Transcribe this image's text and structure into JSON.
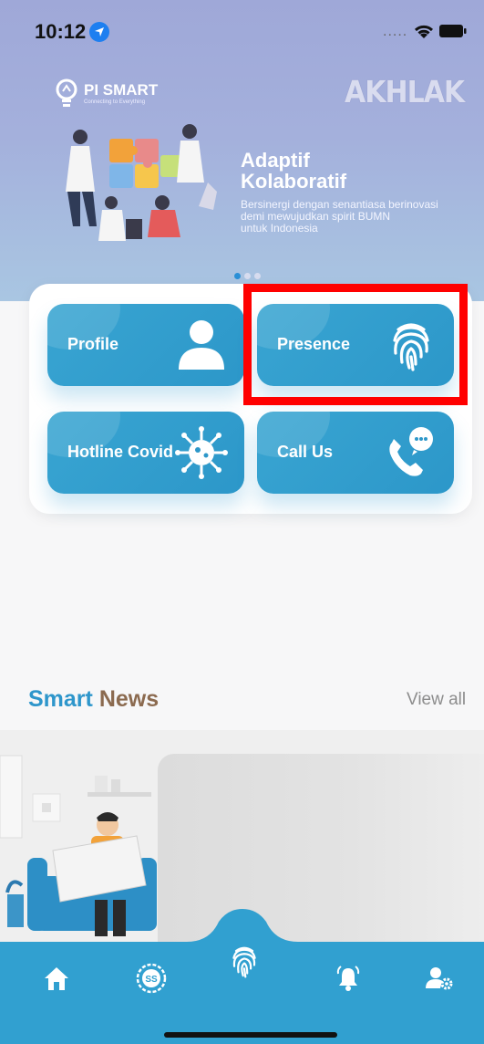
{
  "status_bar": {
    "time": "10:12",
    "signal_dots": "....."
  },
  "banner": {
    "logo_left_title": "PI SMART",
    "logo_left_sub": "Connecting to Everything",
    "logo_right": "AKHLAK",
    "title_line1": "Adaptif",
    "title_line2": "Kolaboratif",
    "desc_line1": "Bersinergi dengan senantiasa berinovasi",
    "desc_line2": "demi mewujudkan spirit BUMN",
    "desc_line3": "untuk Indonesia",
    "pager_count": 3,
    "pager_active": 0
  },
  "menu": {
    "items": [
      {
        "label": "Profile",
        "icon": "person-icon"
      },
      {
        "label": "Presence",
        "icon": "fingerprint-icon"
      },
      {
        "label": "Hotline Covid",
        "icon": "virus-icon"
      },
      {
        "label": "Call Us",
        "icon": "phone-chat-icon"
      }
    ]
  },
  "news": {
    "title_part1": "Smart",
    "title_part2": "News",
    "view_all": "View all"
  },
  "bottom_nav": {
    "items": [
      {
        "name": "home-icon"
      },
      {
        "name": "ss-icon",
        "text": "SS"
      },
      {
        "name": "fingerprint-icon"
      },
      {
        "name": "bell-icon"
      },
      {
        "name": "user-settings-icon"
      }
    ]
  },
  "colors": {
    "primary": "#31a0d0",
    "news_brown": "#8b6a4f",
    "highlight": "#ff0000"
  }
}
